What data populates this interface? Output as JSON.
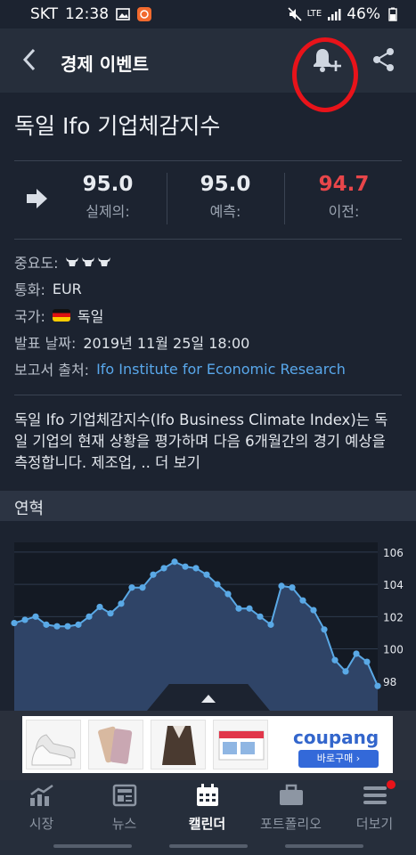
{
  "status": {
    "carrier": "SKT",
    "time": "12:38",
    "network": "LTE",
    "battery": "46%"
  },
  "header": {
    "title": "경제 이벤트",
    "icons": [
      "back-icon",
      "bell-plus-icon",
      "share-icon"
    ]
  },
  "event": {
    "title": "독일 Ifo 기업체감지수",
    "direction_icon": "arrow-right-icon",
    "actual": {
      "value": "95.0",
      "label": "실제의:"
    },
    "forecast": {
      "value": "95.0",
      "label": "예측:"
    },
    "previous": {
      "value": "94.7",
      "label": "이전:"
    }
  },
  "info": {
    "importance_label": "중요도:",
    "importance_level": 3,
    "currency_label": "통화:",
    "currency_value": "EUR",
    "country_label": "국가:",
    "country_value": "독일",
    "date_label": "발표 날짜:",
    "date_value": "2019년 11월 25일 18:00",
    "source_label": "보고서 출처:",
    "source_value": "Ifo Institute for Economic Research"
  },
  "description": {
    "text": "독일 Ifo 기업체감지수(Ifo Business Climate Index)는 독일 기업의 현재 상황을 평가하며 다음 6개월간의 경기 예상을 측정합니다. 제조업, ..",
    "more": "더 보기"
  },
  "history": {
    "title": "연혁"
  },
  "chart_data": {
    "type": "area",
    "y_ticks": [
      "106",
      "104",
      "102",
      "100",
      "98"
    ],
    "ylim": [
      96,
      106.6
    ],
    "values": [
      101.6,
      101.8,
      102.0,
      101.5,
      101.4,
      101.4,
      101.5,
      102.0,
      102.6,
      102.2,
      102.8,
      103.8,
      103.8,
      104.6,
      105.0,
      105.4,
      105.1,
      105.0,
      104.6,
      104.0,
      103.4,
      102.5,
      102.5,
      102.0,
      101.5,
      103.9,
      103.8,
      103.0,
      102.4,
      101.2,
      99.3,
      98.6,
      99.7,
      99.2,
      97.7
    ],
    "grid": true,
    "area_color": "#2f4467",
    "line_color": "#5aa9e6"
  },
  "ad": {
    "brand": "coupang",
    "cta": "바로구매 ›",
    "thumbs": [
      "sneakers",
      "smartphone",
      "fur-coat",
      "mask-box"
    ]
  },
  "tabbar": {
    "items": [
      {
        "label": "시장",
        "icon": "chart-trend-icon"
      },
      {
        "label": "뉴스",
        "icon": "newspaper-icon"
      },
      {
        "label": "캘린더",
        "icon": "calendar-icon",
        "active": true
      },
      {
        "label": "포트폴리오",
        "icon": "briefcase-icon"
      },
      {
        "label": "더보기",
        "icon": "menu-icon"
      }
    ]
  },
  "colors": {
    "background": "#1c2330",
    "header": "#262e3b",
    "accent_link": "#59a8ec",
    "negative": "#e8464a",
    "highlight_circle": "#e8131a"
  }
}
